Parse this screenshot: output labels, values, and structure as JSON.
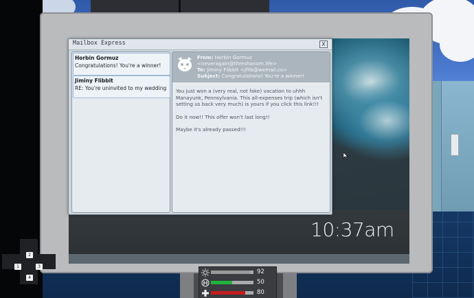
{
  "window": {
    "title": "Mailbox Express",
    "close_label": "X"
  },
  "messages": [
    {
      "from": "Horbin Gormuz",
      "subject": "Congratulations! You're a winner!"
    },
    {
      "from": "Jiminy Flibbit",
      "subject": "RE: You're uninvited to my wedding"
    }
  ],
  "reader": {
    "from_label": "From:",
    "from_name": "Horbin Gormuz",
    "from_email": "<neveragain@threshanom.life>",
    "to_label": "To:",
    "to_value": "Jiminy Flibbit <jflib@wemail.co>",
    "subject_label": "Subject:",
    "subject_value": "Congratulations! You're a winner!",
    "body": [
      "You just won a (very real, not fake) vacation to uhhh Manayunk, Pennsylvania. This all-expenses trip (which isn't setting us back very much) is yours if you click this link!!!",
      "Do it now!! This offer won't last long!!",
      "Maybe it's already passed!!!"
    ]
  },
  "clock": "10:37am",
  "hud": [
    {
      "icon": "light-icon",
      "value": "92",
      "fraction": 0.92,
      "color": "#9a9a9a"
    },
    {
      "icon": "hunger-icon",
      "value": "50",
      "fraction": 0.5,
      "color": "#21b33a"
    },
    {
      "icon": "health-icon",
      "value": "80",
      "fraction": 0.8,
      "color": "#c41d1d"
    }
  ],
  "dpad": {
    "up": "2",
    "left": "1",
    "right": "3",
    "down": "4"
  }
}
